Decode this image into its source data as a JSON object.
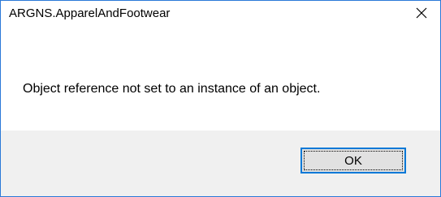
{
  "dialog": {
    "title": "ARGNS.ApparelAndFootwear",
    "message": "Object reference not set to an instance of an object.",
    "ok_label": "OK",
    "close_icon": "close-icon",
    "accent_color": "#2b79d8",
    "footer_color": "#f0f0f0"
  }
}
